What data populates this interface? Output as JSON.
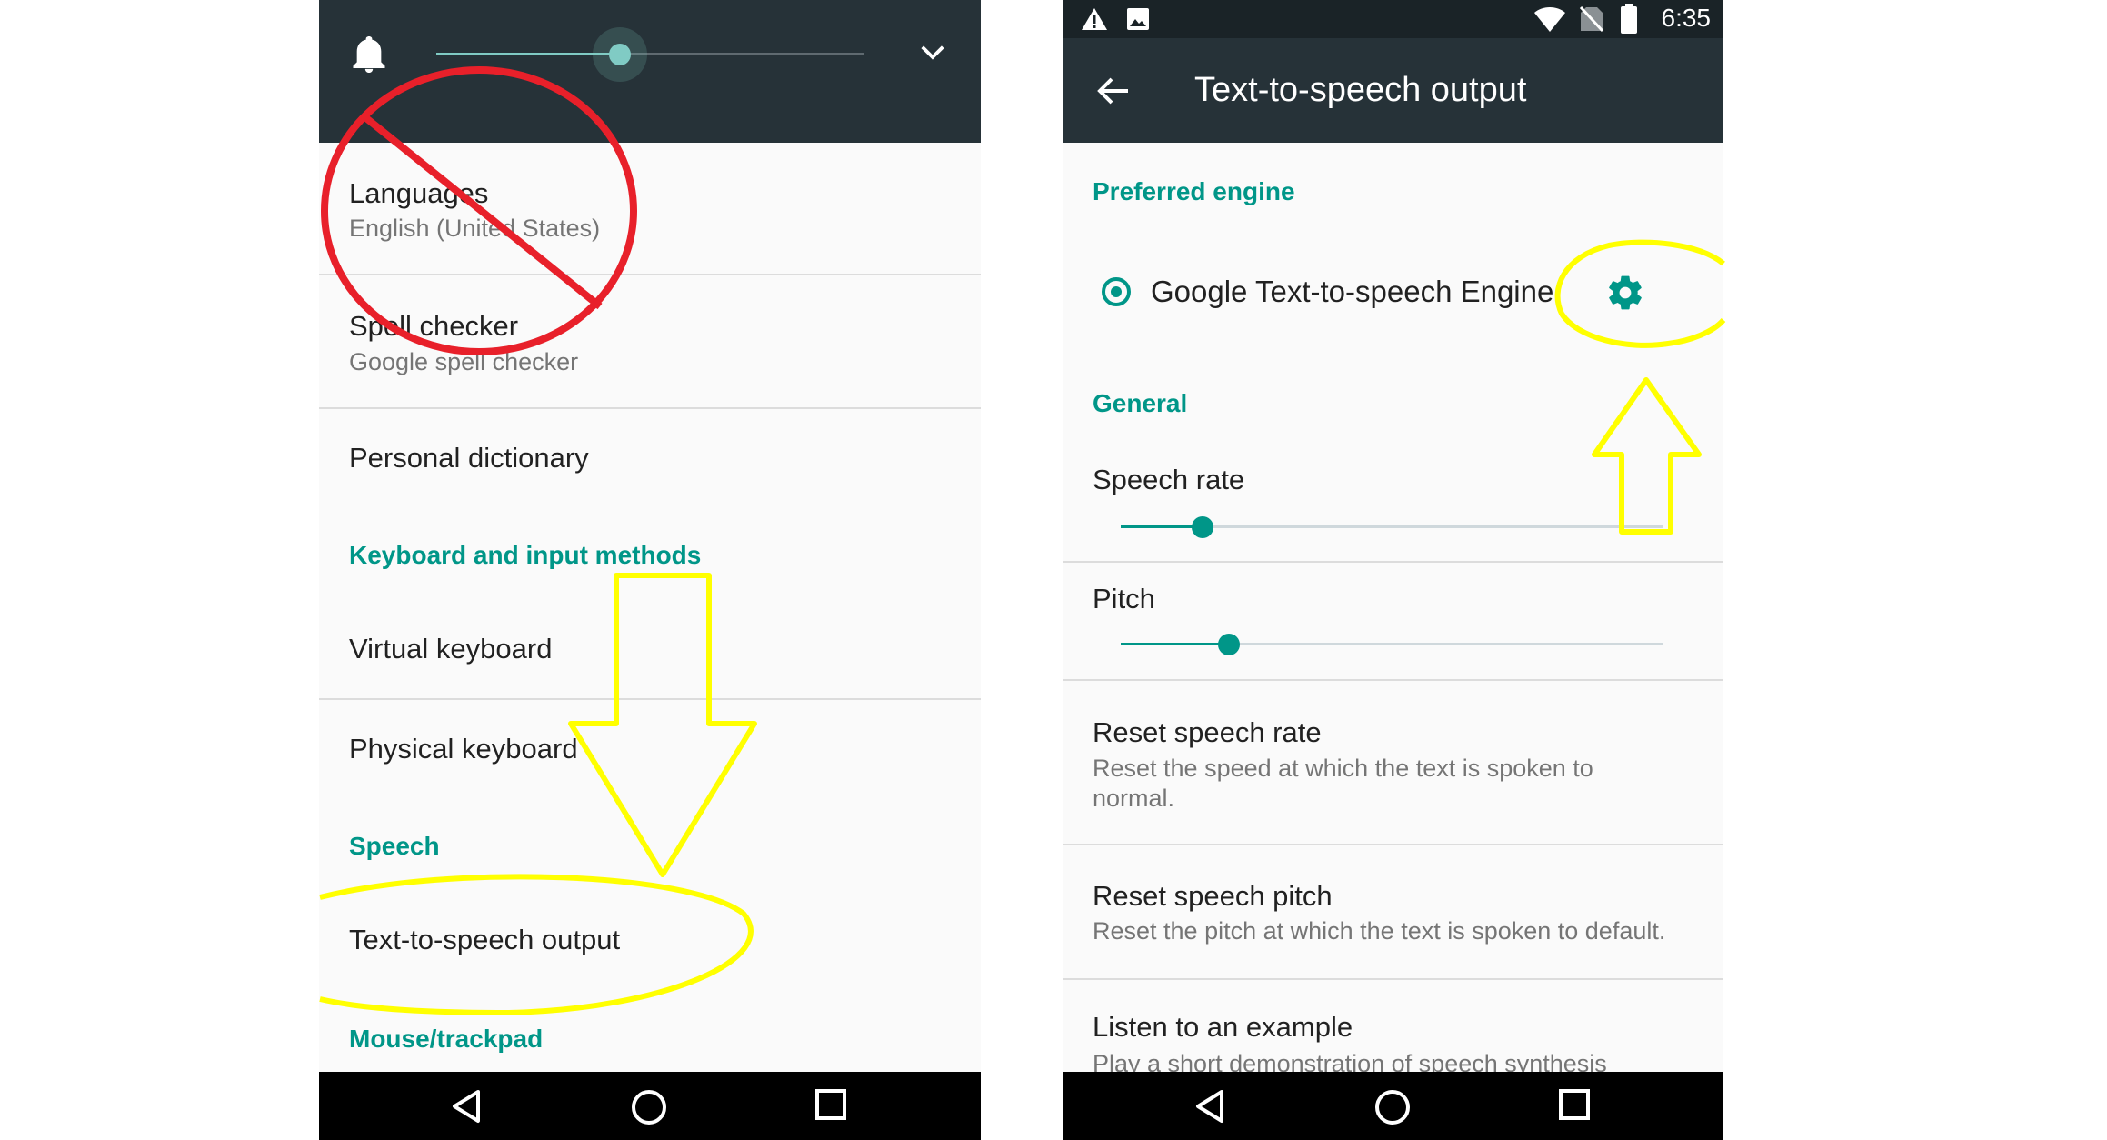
{
  "left_screen": {
    "volume": {
      "level": 0.43
    },
    "items": {
      "languages": {
        "title": "Languages",
        "subtitle": "English (United States)"
      },
      "spell_checker": {
        "title": "Spell checker",
        "subtitle": "Google spell checker"
      },
      "personal_dictionary": {
        "title": "Personal dictionary"
      },
      "section_keyboard": "Keyboard and input methods",
      "virtual_keyboard": {
        "title": "Virtual keyboard"
      },
      "physical_keyboard": {
        "title": "Physical keyboard"
      },
      "section_speech": "Speech",
      "tts_output": {
        "title": "Text-to-speech output"
      },
      "section_mouse": "Mouse/trackpad"
    }
  },
  "right_screen": {
    "status": {
      "time": "6:35"
    },
    "toolbar": {
      "title": "Text-to-speech output"
    },
    "preferred_engine_header": "Preferred engine",
    "engine": {
      "name": "Google Text-to-speech Engine",
      "selected": true
    },
    "general_header": "General",
    "speech_rate": {
      "title": "Speech rate",
      "level": 0.15
    },
    "pitch": {
      "title": "Pitch",
      "level": 0.2
    },
    "reset_rate": {
      "title": "Reset speech rate",
      "subtitle": "Reset the speed at which the text is spoken to normal."
    },
    "reset_pitch": {
      "title": "Reset speech pitch",
      "subtitle": "Reset the pitch at which the text is spoken to default."
    },
    "listen_example": {
      "title": "Listen to an example",
      "subtitle": "Play a short demonstration of speech synthesis"
    }
  },
  "colors": {
    "accent": "#009688",
    "toolbar": "#263238",
    "annotation_red": "#e8202a",
    "annotation_yellow": "#ffff00"
  },
  "icons": [
    "bell-icon",
    "chevron-down-icon",
    "back-arrow-icon",
    "gear-icon",
    "warning-icon",
    "image-icon",
    "wifi-icon",
    "no-sim-icon",
    "battery-icon",
    "nav-back-icon",
    "nav-home-icon",
    "nav-recents-icon"
  ]
}
